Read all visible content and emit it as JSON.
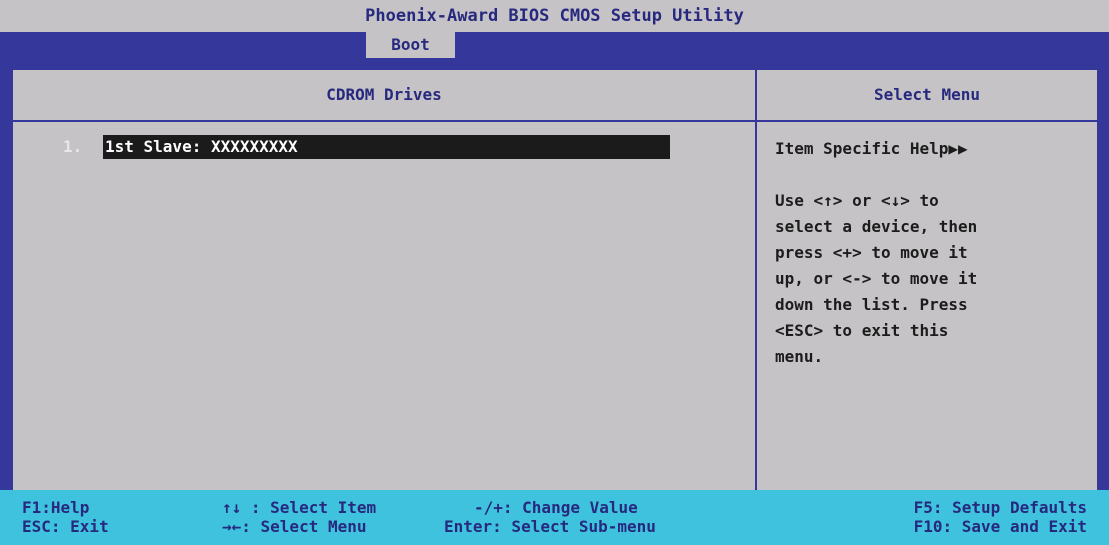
{
  "title": "Phoenix-Award BIOS CMOS Setup Utility",
  "tabs": [
    {
      "label": "Boot",
      "active": true
    }
  ],
  "left_header": "CDROM Drives",
  "right_header": "Select Menu",
  "items": [
    {
      "number": "1.",
      "label": "1st Slave: XXXXXXXXX",
      "selected": true
    }
  ],
  "help": {
    "title": "Item Specific Help▶▶",
    "lines": [
      "Use <↑> or <↓> to",
      "select a device, then",
      "press <+> to move it",
      "up, or <-> to move it",
      "down the list. Press",
      "<ESC> to exit this",
      "menu."
    ]
  },
  "footer": {
    "help_key": "F1:Help",
    "exit_key": "ESC: Exit",
    "select_item": "↑↓ : Select Item",
    "select_menu": "→←: Select Menu",
    "change_value": "-/+: Change Value",
    "select_submenu": "Enter: Select Sub-menu",
    "setup_defaults": "F5: Setup Defaults",
    "save_exit": "F10: Save and Exit"
  },
  "colors": {
    "background": "#35379a",
    "panel": "#c6c3c6",
    "footer": "#3fc2dd",
    "title_text": "#27297f",
    "selection": "#1b1b1b"
  }
}
